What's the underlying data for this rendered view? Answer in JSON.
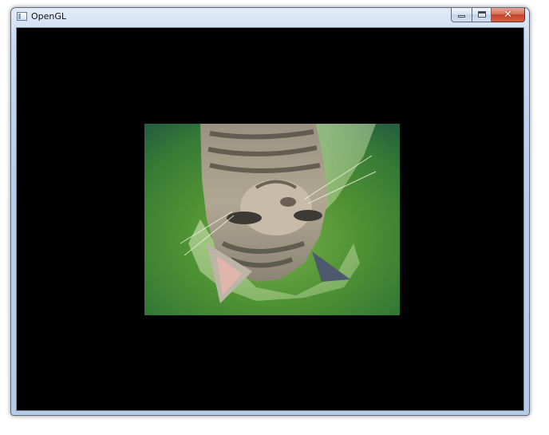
{
  "window": {
    "title": "OpenGL"
  },
  "titlebar": {
    "app_icon": "window-app-icon",
    "buttons": {
      "minimize_icon": "minimize-icon",
      "maximize_icon": "maximize-icon",
      "close_icon": "close-icon",
      "close_glyph": "✕"
    }
  },
  "viewport": {
    "background_color": "#000000",
    "texture_subject": "kitten-texture"
  }
}
